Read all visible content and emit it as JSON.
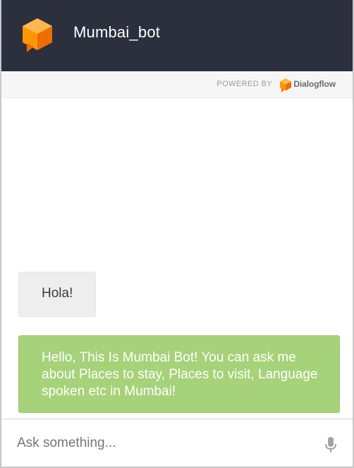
{
  "header": {
    "bot_name": "Mumbai_bot",
    "logo_icon": "dialogflow-cube-icon",
    "background": "#2b2f3e"
  },
  "powered_by": {
    "label": "POWERED BY",
    "brand": "Dialogflow",
    "brand_icon": "dialogflow-logo-icon"
  },
  "messages": [
    {
      "sender": "user",
      "text": "Hola!"
    },
    {
      "sender": "bot",
      "text": "Hello, This Is Mumbai Bot! You can ask me about Places to stay, Places to visit, Language spoken etc in Mumbai!"
    }
  ],
  "input": {
    "placeholder": "Ask something...",
    "value": "",
    "mic_icon": "microphone-icon"
  },
  "colors": {
    "accent_orange": "#f7830f",
    "bot_bubble": "#a6d27a",
    "user_bubble": "#eeeeee"
  }
}
